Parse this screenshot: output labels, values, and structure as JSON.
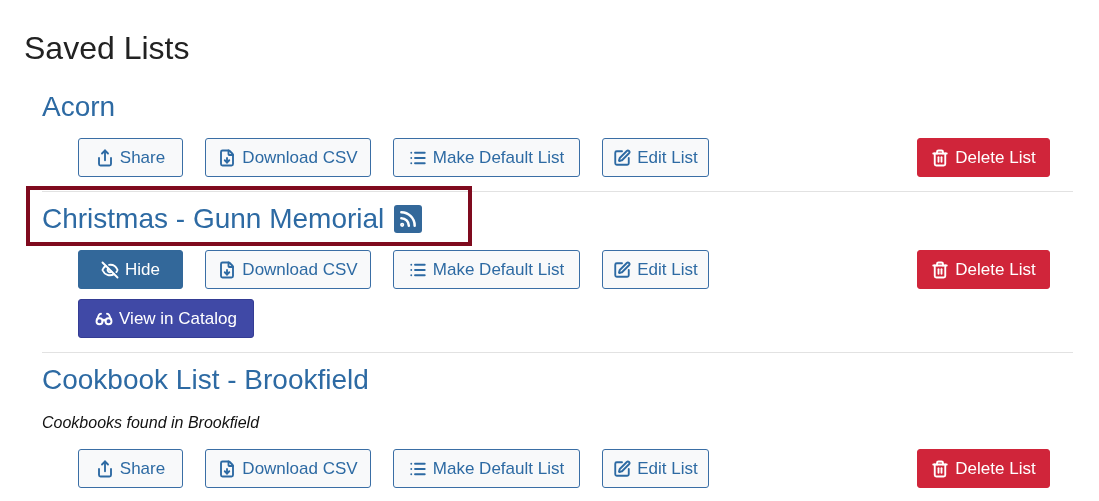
{
  "heading": "Saved Lists",
  "lists": [
    {
      "title": "Acorn",
      "highlighted": false,
      "rss": false,
      "button_rows": [
        [
          {
            "kind": "share",
            "label": "Share"
          },
          {
            "kind": "download",
            "label": "Download CSV"
          },
          {
            "kind": "default",
            "label": "Make Default List"
          },
          {
            "kind": "edit",
            "label": "Edit List"
          },
          {
            "kind": "delete",
            "label": "Delete List"
          }
        ]
      ]
    },
    {
      "title": "Christmas - Gunn Memorial",
      "highlighted": true,
      "rss": true,
      "button_rows": [
        [
          {
            "kind": "hide",
            "label": "Hide"
          },
          {
            "kind": "download",
            "label": "Download CSV"
          },
          {
            "kind": "default",
            "label": "Make Default List"
          },
          {
            "kind": "edit",
            "label": "Edit List"
          },
          {
            "kind": "delete",
            "label": "Delete List"
          }
        ],
        [
          {
            "kind": "catalog",
            "label": "View in Catalog"
          }
        ]
      ]
    },
    {
      "title": "Cookbook List - Brookfield",
      "highlighted": false,
      "rss": false,
      "description": "Cookbooks found in Brookfield",
      "button_rows": [
        [
          {
            "kind": "share",
            "label": "Share"
          },
          {
            "kind": "download",
            "label": "Download CSV"
          },
          {
            "kind": "default",
            "label": "Make Default List"
          },
          {
            "kind": "edit",
            "label": "Edit List"
          },
          {
            "kind": "delete",
            "label": "Delete List"
          }
        ]
      ]
    }
  ]
}
